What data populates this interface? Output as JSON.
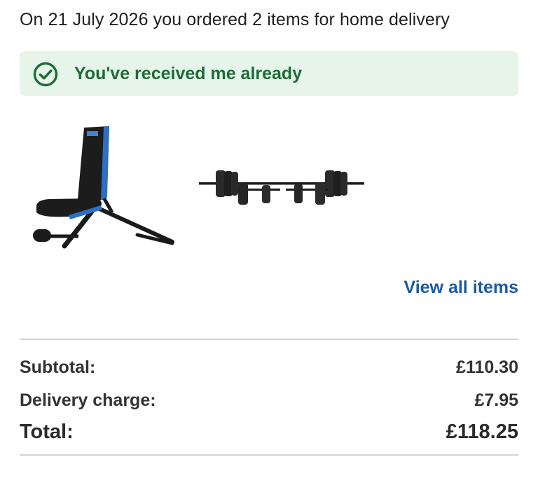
{
  "order": {
    "summary": "On 21 July 2026 you ordered 2 items for home delivery"
  },
  "status": {
    "text": "You've received me already",
    "icon": "check-circle-icon",
    "background_color": "#e7f4ea",
    "text_color": "#1e6b36"
  },
  "items": [
    {
      "icon": "weight-bench-image"
    },
    {
      "icon": "barbell-dumbbell-set-image"
    }
  ],
  "links": {
    "view_all": "View all items",
    "color": "#1c5aa0"
  },
  "totals": {
    "subtotal_label": "Subtotal:",
    "subtotal_value": "£110.30",
    "delivery_label": "Delivery charge:",
    "delivery_value": "£7.95",
    "total_label": "Total:",
    "total_value": "£118.25"
  }
}
